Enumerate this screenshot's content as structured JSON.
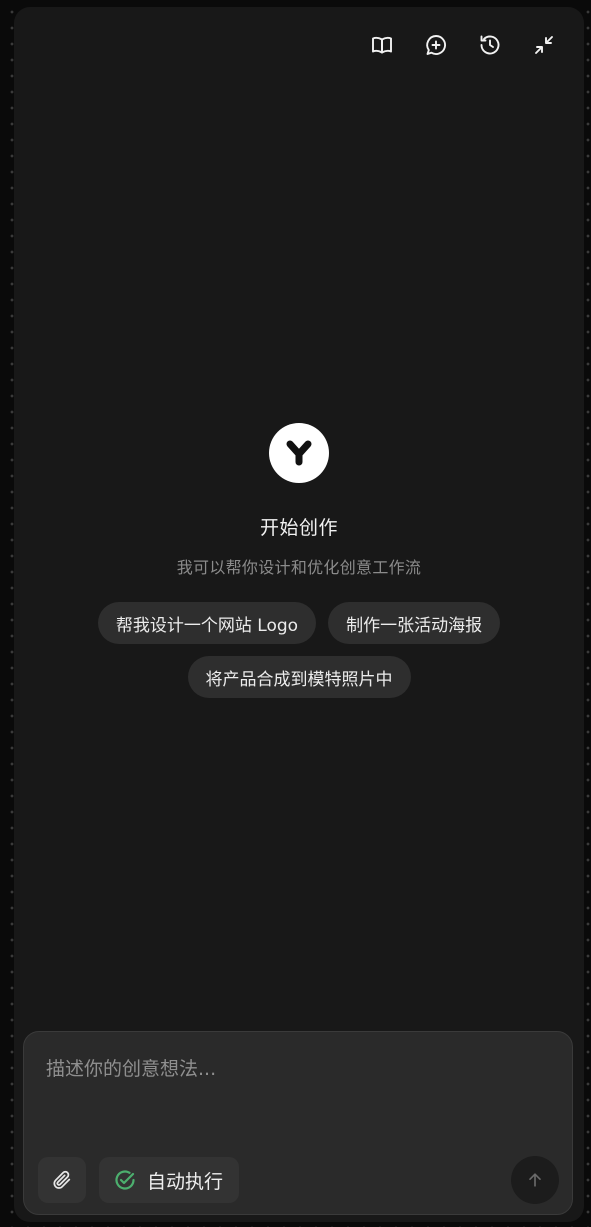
{
  "header": {
    "icons": [
      "book-open-icon",
      "new-chat-icon",
      "history-icon",
      "minimize-icon"
    ]
  },
  "hero": {
    "logo_icon": "y-logo-icon",
    "title": "开始创作",
    "subtitle": "我可以帮你设计和优化创意工作流"
  },
  "suggestions": [
    {
      "label": "帮我设计一个网站 Logo"
    },
    {
      "label": "制作一张活动海报"
    },
    {
      "label": "将产品合成到模特照片中"
    }
  ],
  "composer": {
    "placeholder": "描述你的创意想法...",
    "value": "",
    "attach_icon": "paperclip-icon",
    "auto_label": "自动执行",
    "auto_icon": "check-circle-icon",
    "send_icon": "arrow-up-icon"
  },
  "colors": {
    "background": "#181818",
    "chip": "#2e2e2e",
    "composer": "#2a2a2a",
    "accent_green": "#4caf6e"
  }
}
